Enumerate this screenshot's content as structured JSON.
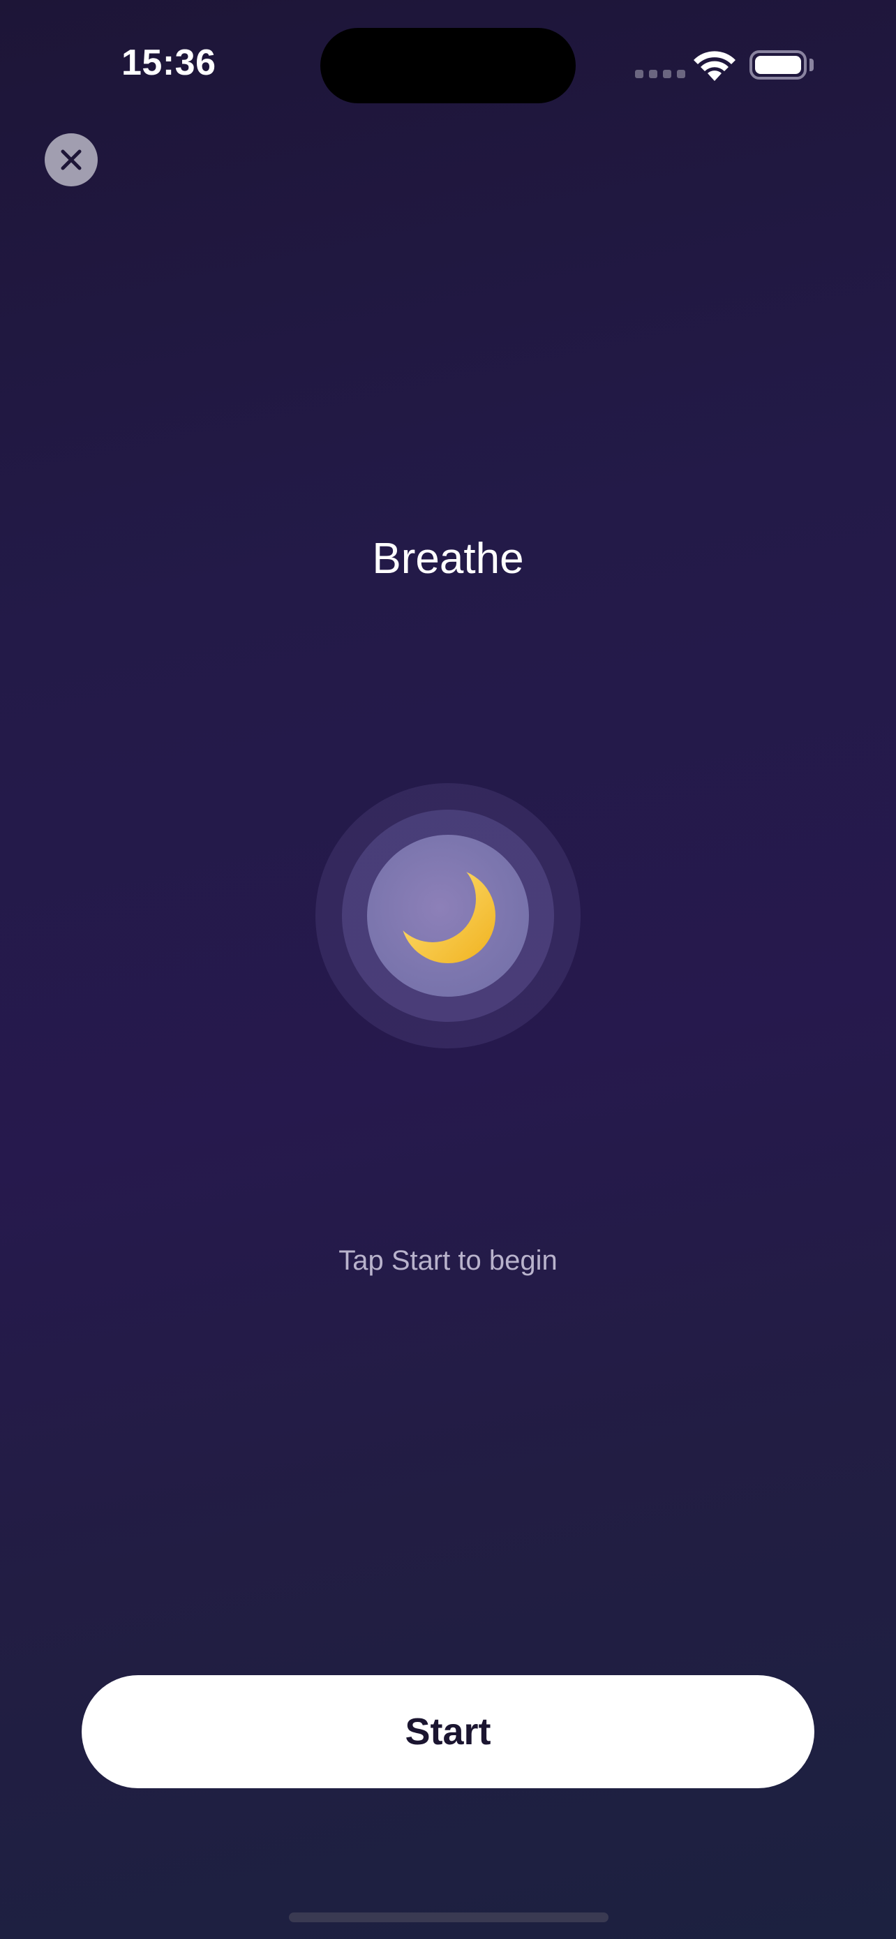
{
  "status_bar": {
    "time": "15:36",
    "wifi_icon": "wifi-icon",
    "battery_icon": "battery-icon"
  },
  "header": {
    "close_icon": "close-icon"
  },
  "main": {
    "title": "Breathe",
    "center_icon": "crescent-moon-icon",
    "prompt": "Tap Start to begin"
  },
  "footer": {
    "start_label": "Start"
  },
  "colors": {
    "background_top": "#1d1537",
    "background_mid": "#26194d",
    "background_bottom": "#1c2140",
    "button_bg": "#ffffff",
    "button_text": "#1b1530",
    "moon": "#f5c842"
  }
}
